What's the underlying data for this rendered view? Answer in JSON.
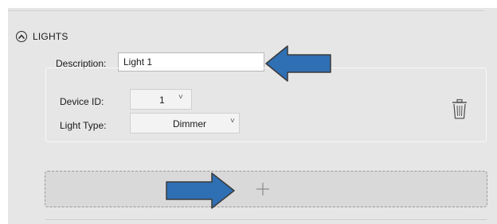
{
  "section": {
    "title": "LIGHTS",
    "collapse_icon": "chevron-up-circle-icon"
  },
  "description": {
    "label": "Description:",
    "value": "Light 1"
  },
  "light": {
    "device_id_label": "Device ID:",
    "device_id_value": "1",
    "light_type_label": "Light Type:",
    "light_type_value": "Dimmer",
    "chevron": "˅",
    "delete_icon": "trash-icon"
  },
  "add": {
    "icon": "plus-icon"
  },
  "annotations": {
    "arrow_color": "#2f6fb3",
    "arrow_outline": "#3a3a3a"
  }
}
